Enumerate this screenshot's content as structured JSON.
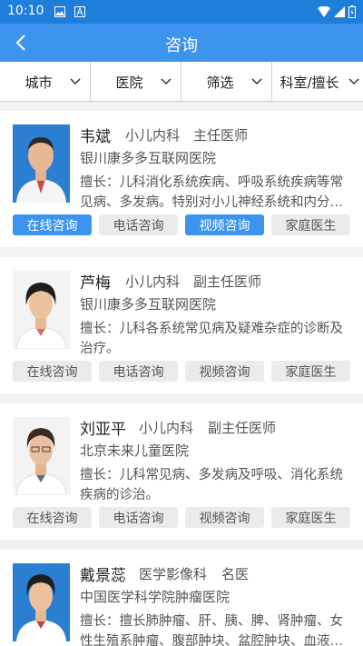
{
  "status_bar": {
    "time": "10:10"
  },
  "app_bar": {
    "title": "咨询"
  },
  "filters": [
    {
      "label": "城市"
    },
    {
      "label": "医院"
    },
    {
      "label": "筛选"
    },
    {
      "label": "科室/擅长"
    }
  ],
  "doctors": [
    {
      "name": "韦斌",
      "dept": "小儿内科",
      "title": "主任医师",
      "hospital": "银川康多多互联网医院",
      "desc": "擅长：儿科消化系统疾病、呼吸系统疾病等常见病、多发病。特别对小儿神经系统和内分…",
      "buttons": [
        {
          "label": "在线咨询",
          "active": true
        },
        {
          "label": "电话咨询",
          "active": false
        },
        {
          "label": "视频咨询",
          "active": true
        },
        {
          "label": "家庭医生",
          "active": false
        }
      ]
    },
    {
      "name": "芦梅",
      "dept": "小儿内科",
      "title": "副主任医师",
      "hospital": "银川康多多互联网医院",
      "desc": "擅长：儿科各系统常见病及疑难杂症的诊断及治疗。",
      "buttons": [
        {
          "label": "在线咨询",
          "active": false
        },
        {
          "label": "电话咨询",
          "active": false
        },
        {
          "label": "视频咨询",
          "active": false
        },
        {
          "label": "家庭医生",
          "active": false
        }
      ]
    },
    {
      "name": "刘亚平",
      "dept": "小儿内科",
      "title": "副主任医师",
      "hospital": "北京未来儿童医院",
      "desc": "擅长：儿科常见病、多发病及呼吸、消化系统疾病的诊治。",
      "buttons": [
        {
          "label": "在线咨询",
          "active": false
        },
        {
          "label": "电话咨询",
          "active": false
        },
        {
          "label": "视频咨询",
          "active": false
        },
        {
          "label": "家庭医生",
          "active": false
        }
      ]
    },
    {
      "name": "戴景蕊",
      "dept": "医学影像科",
      "title": "名医",
      "hospital": "中国医学科学院肿瘤医院",
      "desc": "擅长：擅长肺肿瘤、肝、胰、脾、肾肿瘤、女性生殖系肿瘤、腹部肿块、盆腔肿块、血液…",
      "buttons": []
    }
  ],
  "colors": {
    "primary": "#3d94ef",
    "status_bar": "#1f7ed9",
    "button_inactive": "#ebebeb"
  }
}
